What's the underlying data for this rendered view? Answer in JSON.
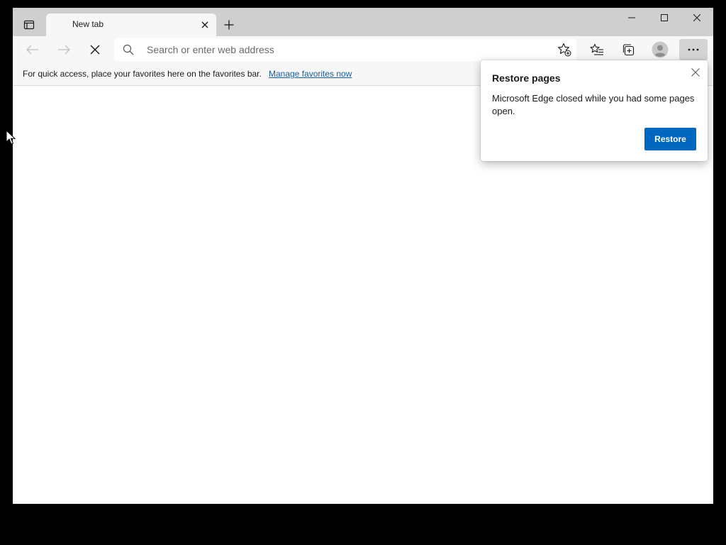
{
  "tab": {
    "title": "New tab"
  },
  "address_bar": {
    "placeholder": "Search or enter web address",
    "value": ""
  },
  "favorites_bar": {
    "message": "For quick access, place your favorites here on the favorites bar.",
    "link_label": "Manage favorites now"
  },
  "restore_flyout": {
    "title": "Restore pages",
    "message": "Microsoft Edge closed while you had some pages open.",
    "button_label": "Restore"
  },
  "icons": {
    "tab_actions": "tab-actions-icon",
    "tab_close": "close-icon",
    "new_tab": "plus-icon",
    "back": "arrow-left-icon",
    "forward": "arrow-right-icon",
    "stop": "close-icon",
    "search": "search-icon",
    "add_favorite": "star-add-icon",
    "favorites": "favorites-list-icon",
    "collections": "collections-icon",
    "profile": "profile-icon",
    "more": "more-icon"
  },
  "colors": {
    "accent": "#0067c0",
    "link": "#1a5fa8",
    "tabstrip": "#cfcfcf",
    "toolbar": "#f7f7f7"
  }
}
